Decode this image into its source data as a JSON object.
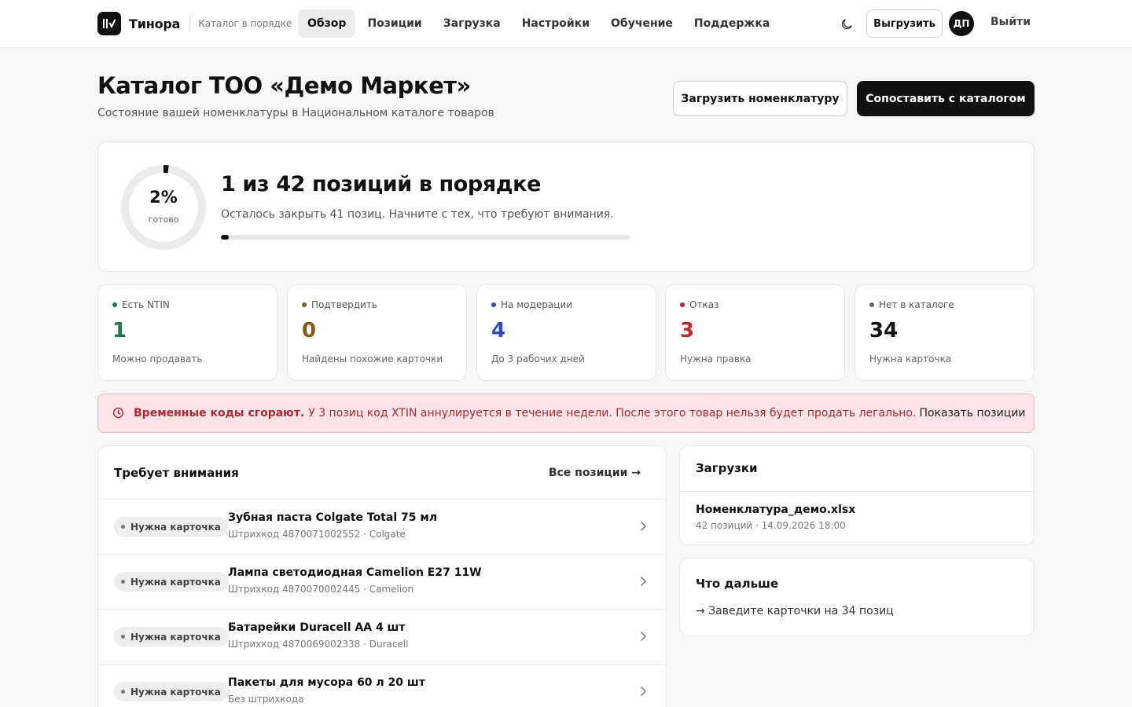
{
  "brand": {
    "name": "Тинора",
    "tagline": "Каталог в порядке"
  },
  "nav": {
    "items": [
      {
        "label": "Обзор",
        "active": true
      },
      {
        "label": "Позиции",
        "active": false
      },
      {
        "label": "Загрузка",
        "active": false
      },
      {
        "label": "Настройки",
        "active": false
      },
      {
        "label": "Обучение",
        "active": false
      },
      {
        "label": "Поддержка",
        "active": false
      }
    ],
    "theme_icon": "moon-icon",
    "export_label": "Выгрузить",
    "avatar_initials": "ДП",
    "logout_label": "Выйти"
  },
  "page": {
    "title": "Каталог ТОО «Демо Маркет»",
    "subtitle": "Состояние вашей номенклатуры в Национальном каталоге товаров",
    "upload_button": "Загрузить номенклатуру",
    "match_button": "Сопоставить с каталогом"
  },
  "progress": {
    "percent_label": "2%",
    "ready_label": "готово",
    "fraction": 0.02,
    "headline": "1 из 42 позиций в порядке",
    "note": "Осталось закрыть 41 позиц. Начните с тех, что требуют внимания."
  },
  "stats": [
    {
      "label": "Есть NTIN",
      "value": "1",
      "caption": "Можно продавать",
      "color": "#1f7a45"
    },
    {
      "label": "Подтвердить",
      "value": "0",
      "caption": "Найдены похожие карточки",
      "color": "#8a5a12"
    },
    {
      "label": "На модерации",
      "value": "4",
      "caption": "До 3 рабочих дней",
      "color": "#2d4dbf"
    },
    {
      "label": "Отказ",
      "value": "3",
      "caption": "Нужна правка",
      "color": "#c0262f"
    },
    {
      "label": "Нет в каталоге",
      "value": "34",
      "caption": "Нужна карточка",
      "color": "#111111",
      "dot_color": "#666666"
    }
  ],
  "alert": {
    "icon": "clock-icon",
    "strong": "Временные коды сгорают.",
    "text": "У 3 позиц код XTIN аннулируется в течение недели. После этого товар нельзя будет продать легально.",
    "link": "Показать позиции"
  },
  "attention": {
    "title": "Требует внимания",
    "all_link": "Все позиции →",
    "rows": [
      {
        "badge": "Нужна карточка",
        "name": "Зубная паста Colgate Total 75 мл",
        "meta": "Штрихкод 4870071002552 · Colgate"
      },
      {
        "badge": "Нужна карточка",
        "name": "Лампа светодиодная Camelion E27 11W",
        "meta": "Штрихкод 4870070002445 · Camelion"
      },
      {
        "badge": "Нужна карточка",
        "name": "Батарейки Duracell AA 4 шт",
        "meta": "Штрихкод 4870069002338 · Duracell"
      },
      {
        "badge": "Нужна карточка",
        "name": "Пакеты для мусора 60 л 20 шт",
        "meta": "Без штрихкода"
      }
    ]
  },
  "uploads": {
    "title": "Загрузки",
    "file_name": "Номенклатура_демо.xlsx",
    "file_meta": "42 позиций · 14.09.2026 18:00"
  },
  "next": {
    "title": "Что дальше",
    "item": "→ Заведите карточки на 34 позиц"
  }
}
